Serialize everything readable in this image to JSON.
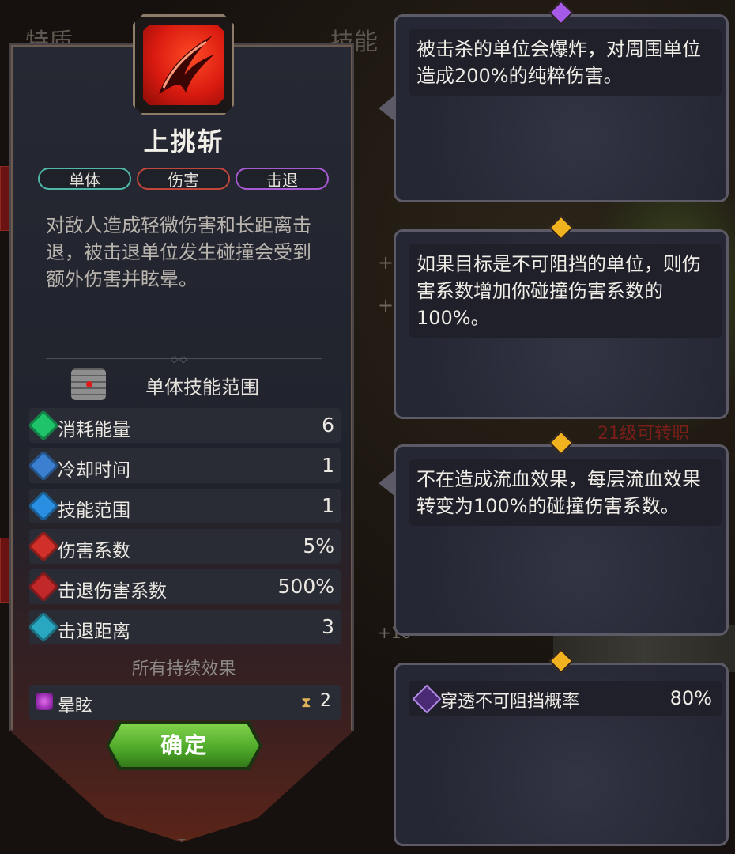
{
  "background": {
    "tab_left": "特质",
    "tab_right": "技能",
    "plus_1": "+",
    "plus_2": "+",
    "plus_3": "+10",
    "red_text": "21级可转职"
  },
  "skill": {
    "name": "上挑斩",
    "tags": [
      "单体",
      "伤害",
      "击退"
    ],
    "description": "对敌人造成轻微伤害和长距离击退，被击退单位发生碰撞会受到额外伤害并眩晕。",
    "range_label": "单体技能范围",
    "stats": [
      {
        "icon": "energy-icon",
        "label": "消耗能量",
        "value": "6",
        "color": "#1fc36a"
      },
      {
        "icon": "cooldown-icon",
        "label": "冷却时间",
        "value": "1",
        "color": "#3a7fd0"
      },
      {
        "icon": "range-icon",
        "label": "技能范围",
        "value": "1",
        "color": "#2a8fe0"
      },
      {
        "icon": "damage-icon",
        "label": "伤害系数",
        "value": "5%",
        "color": "#d02f2a"
      },
      {
        "icon": "knockback-damage-icon",
        "label": "击退伤害系数",
        "value": "500%",
        "color": "#c0282a"
      },
      {
        "icon": "knockback-distance-icon",
        "label": "击退距离",
        "value": "3",
        "color": "#2aa7c0"
      }
    ],
    "effects_title": "所有持续效果",
    "effect": {
      "icon": "stun-icon",
      "label": "晕眩",
      "timer_icon": "hourglass-icon",
      "duration": "2"
    },
    "confirm_label": "确定"
  },
  "cards": [
    {
      "gem_color": "#a65be8",
      "text": "被击杀的单位会爆炸，对周围单位造成200%的纯粹伤害。"
    },
    {
      "gem_color": "#f0b21e",
      "text": "如果目标是不可阻挡的单位，则伤害系数增加你碰撞伤害系数的100%。"
    },
    {
      "gem_color": "#f0b21e",
      "text": "不在造成流血效果，每层流血效果转变为100%的碰撞伤害系数。"
    },
    {
      "gem_color": "#f0b21e",
      "stat_icon": "penetration-icon",
      "stat_label": "穿透不可阻挡概率",
      "stat_value": "80%"
    }
  ]
}
